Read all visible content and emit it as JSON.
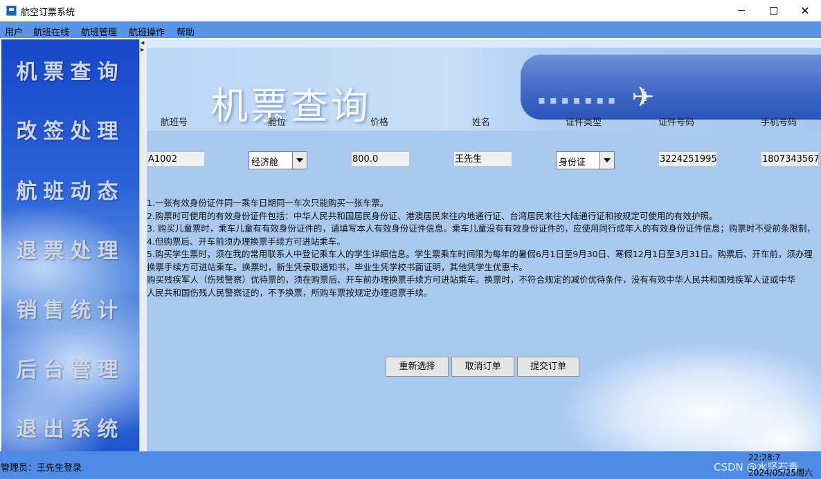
{
  "window": {
    "title": "航空订票系统"
  },
  "menu": [
    "用户",
    "航班在线",
    "航班管理",
    "航班操作",
    "帮助"
  ],
  "sidebar": [
    "机票查询",
    "改签处理",
    "航班动态",
    "退票处理",
    "销售统计",
    "后台管理",
    "退出系统"
  ],
  "banner": {
    "title": "机票查询"
  },
  "form": {
    "labels": [
      "航班号",
      "舱位",
      "价格",
      "姓名",
      "证件类型",
      "证件号码",
      "手机号码"
    ],
    "flight_no": "A1002",
    "cabin": "经济舱",
    "price": "800.0",
    "name": "王先生",
    "id_type": "身份证",
    "id_number": "3224251995",
    "phone": "1807343567"
  },
  "notice": [
    "1.一张有效身份证件同一乘车日期同一车次只能购买一张车票。",
    "2.购票时可使用的有效身份证件包括：中华人民共和国居民身份证、港澳居民来往内地通行证、台湾居民来往大陆通行证和按规定可使用的有效护照。",
    "3. 购买儿童票时，乘车儿童有有效身份证件的，请填写本人有效身份证件信息。乘车儿童没有有效身份证件的，应使用同行成年人的有效身份证件信息；购票时不受前条限制，",
    "4.但购票后、开车前须办理换票手续方可进站乘车。",
    "5.购买学生票时，须在我的常用联系人中登记乘车人的学生详细信息。学生票乘车时间限为每年的暑假6月1日至9月30日、寒假12月1日至3月31日。购票后、开车前，须办理换票手续方可进站乘车。换票时，新生凭录取通知书，毕业生凭学校书面证明，其他凭学生优惠卡。",
    "购买残疾军人（伤残警察）优待票的，须在购票后、开车前办理换票手续方可进站乘车。换票时，不符合规定的减价优待条件，没有有效中华人民共和国残疾军人证或中华",
    "人民共和国伤残人民警察证的，不予换票，所购车票按规定办理退票手续。"
  ],
  "buttons": {
    "reset": "重新选择",
    "cancel": "取消订单",
    "submit": "提交订单"
  },
  "status": {
    "login": "管理员：王先生登录",
    "time": "22:28:7",
    "date": "2024/05/25周六",
    "watermark": "CSDN @水坚石青"
  }
}
